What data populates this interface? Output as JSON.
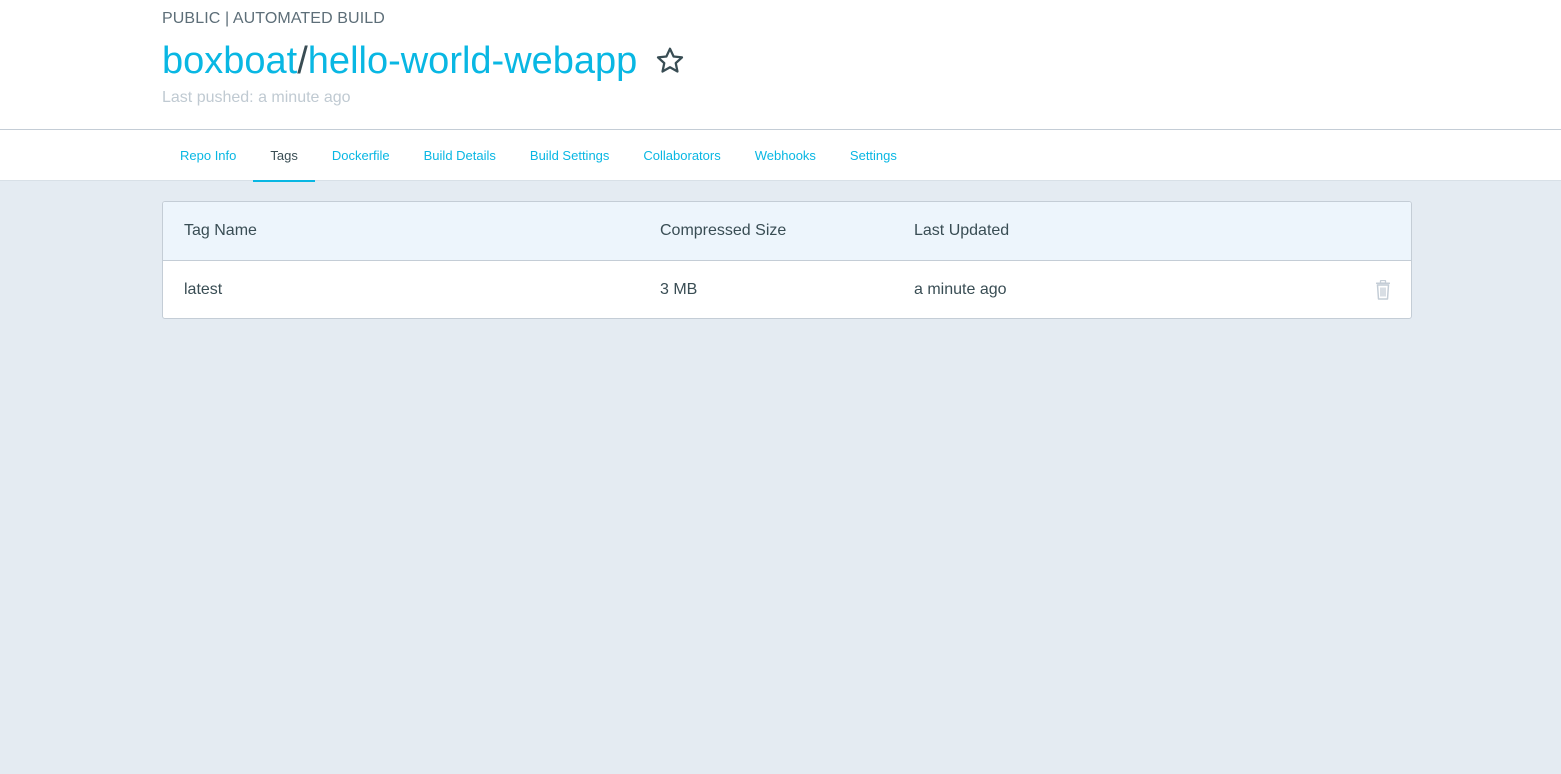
{
  "repo": {
    "visibility_label": "PUBLIC | AUTOMATED BUILD",
    "namespace": "boxboat",
    "separator": "/",
    "name": "hello-world-webapp",
    "last_pushed": "Last pushed: a minute ago"
  },
  "tabs": [
    {
      "label": "Repo Info",
      "active": false
    },
    {
      "label": "Tags",
      "active": true
    },
    {
      "label": "Dockerfile",
      "active": false
    },
    {
      "label": "Build Details",
      "active": false
    },
    {
      "label": "Build Settings",
      "active": false
    },
    {
      "label": "Collaborators",
      "active": false
    },
    {
      "label": "Webhooks",
      "active": false
    },
    {
      "label": "Settings",
      "active": false
    }
  ],
  "tags_table": {
    "headers": {
      "tag_name": "Tag Name",
      "compressed_size": "Compressed Size",
      "last_updated": "Last Updated"
    },
    "rows": [
      {
        "tag_name": "latest",
        "compressed_size": "3 MB",
        "last_updated": "a minute ago"
      }
    ]
  },
  "icons": {
    "star": "star-outline-icon",
    "delete": "trash-icon"
  },
  "colors": {
    "accent": "#09b7e3",
    "text": "#394d54",
    "muted": "#c0cad2",
    "page_bg": "#e4ebf2",
    "table_header_bg": "#edf5fc"
  }
}
